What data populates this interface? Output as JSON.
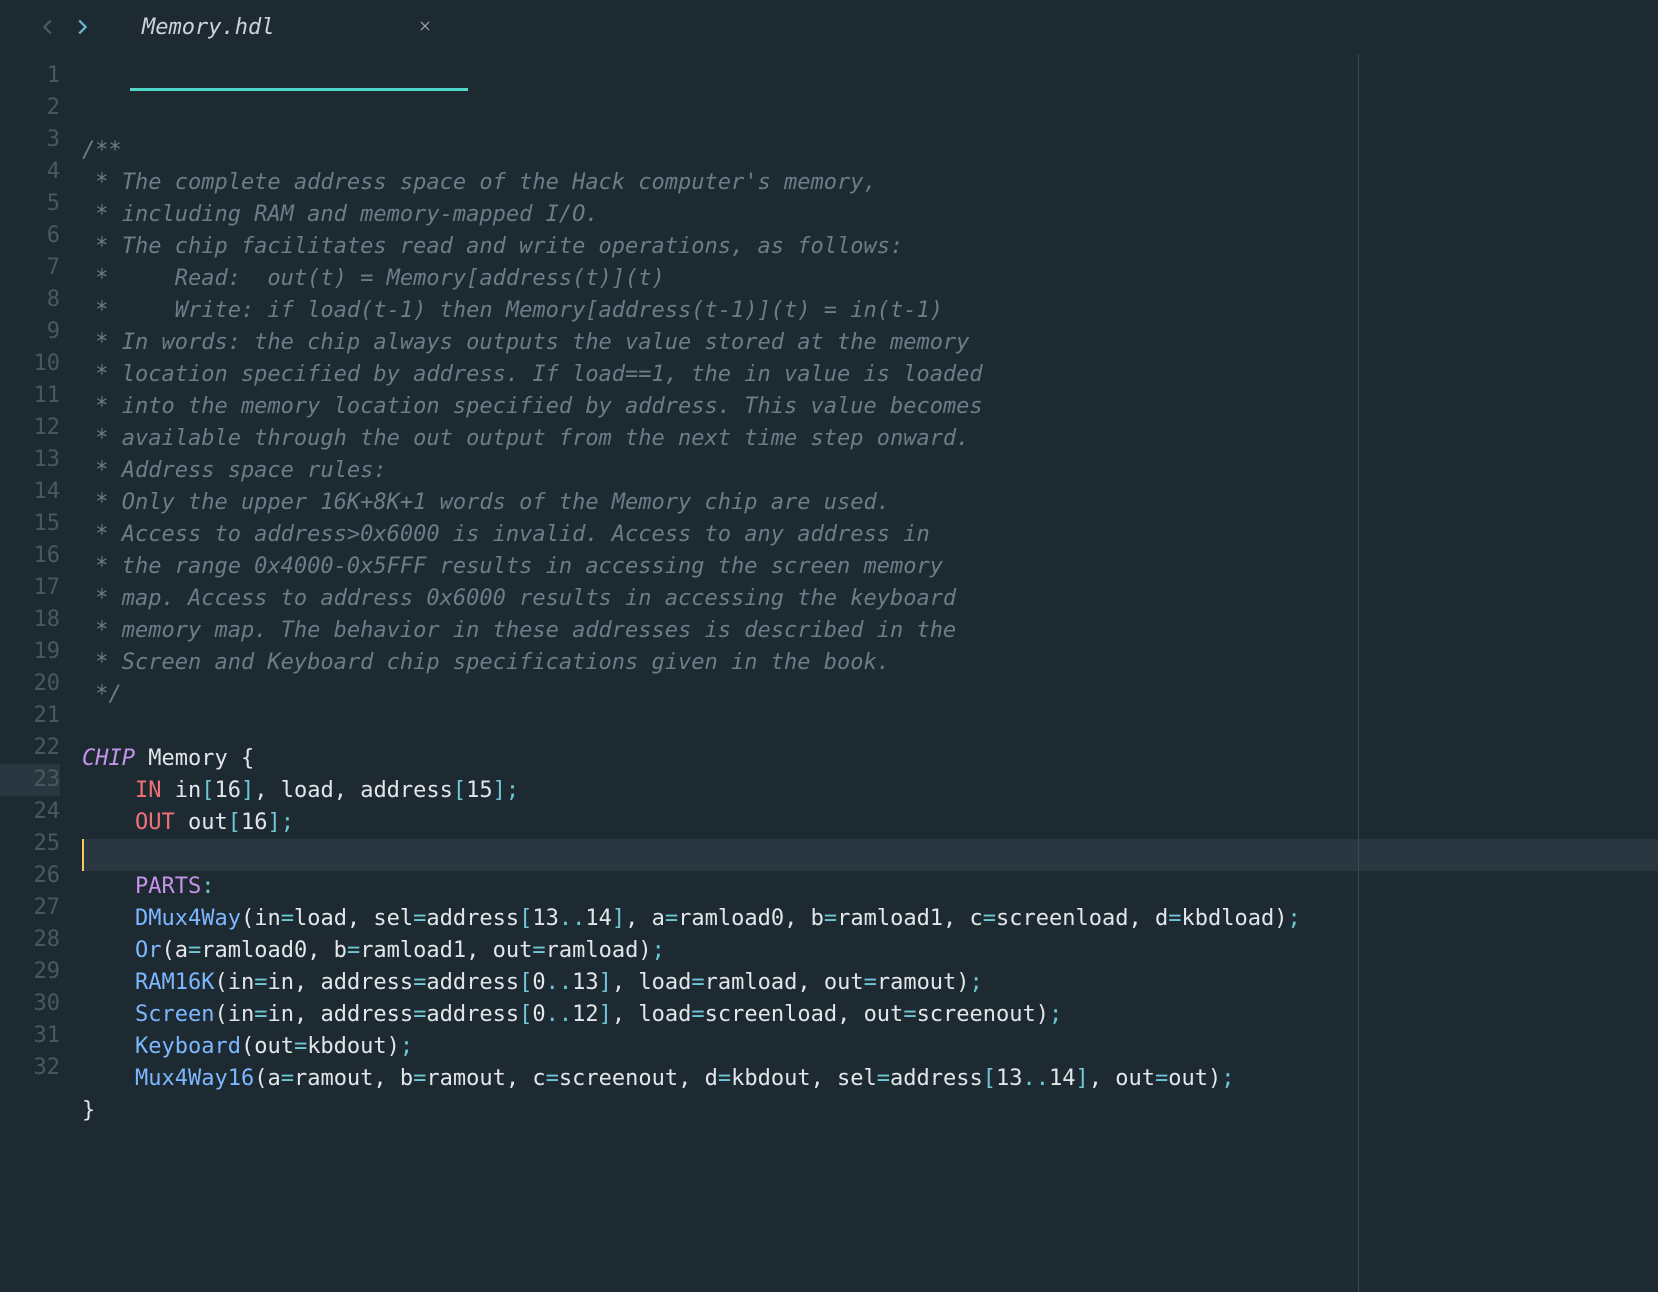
{
  "tab": {
    "filename": "Memory.hdl",
    "close_tooltip": "Close"
  },
  "editor": {
    "current_line": 23,
    "line_count": 32,
    "lines": [
      {
        "n": 1,
        "t": "/**",
        "cls": "cm"
      },
      {
        "n": 2,
        "t": " * The complete address space of the Hack computer's memory,",
        "cls": "cm"
      },
      {
        "n": 3,
        "t": " * including RAM and memory-mapped I/O.",
        "cls": "cm"
      },
      {
        "n": 4,
        "t": " * The chip facilitates read and write operations, as follows:",
        "cls": "cm"
      },
      {
        "n": 5,
        "t": " *     Read:  out(t) = Memory[address(t)](t)",
        "cls": "cm"
      },
      {
        "n": 6,
        "t": " *     Write: if load(t-1) then Memory[address(t-1)](t) = in(t-1)",
        "cls": "cm"
      },
      {
        "n": 7,
        "t": " * In words: the chip always outputs the value stored at the memory",
        "cls": "cm"
      },
      {
        "n": 8,
        "t": " * location specified by address. If load==1, the in value is loaded",
        "cls": "cm"
      },
      {
        "n": 9,
        "t": " * into the memory location specified by address. This value becomes",
        "cls": "cm"
      },
      {
        "n": 10,
        "t": " * available through the out output from the next time step onward.",
        "cls": "cm"
      },
      {
        "n": 11,
        "t": " * Address space rules:",
        "cls": "cm"
      },
      {
        "n": 12,
        "t": " * Only the upper 16K+8K+1 words of the Memory chip are used.",
        "cls": "cm"
      },
      {
        "n": 13,
        "t": " * Access to address>0x6000 is invalid. Access to any address in",
        "cls": "cm"
      },
      {
        "n": 14,
        "t": " * the range 0x4000-0x5FFF results in accessing the screen memory",
        "cls": "cm"
      },
      {
        "n": 15,
        "t": " * map. Access to address 0x6000 results in accessing the keyboard",
        "cls": "cm"
      },
      {
        "n": 16,
        "t": " * memory map. The behavior in these addresses is described in the",
        "cls": "cm"
      },
      {
        "n": 17,
        "t": " * Screen and Keyboard chip specifications given in the book.",
        "cls": "cm"
      },
      {
        "n": 18,
        "t": " */",
        "cls": "cm"
      },
      {
        "n": 19,
        "t": "",
        "cls": ""
      },
      {
        "n": 20,
        "segs": [
          {
            "t": "CHIP",
            "c": "kw"
          },
          {
            "t": " Memory ",
            "c": "id"
          },
          {
            "t": "{",
            "c": "id"
          }
        ]
      },
      {
        "n": 21,
        "segs": [
          {
            "t": "    ",
            "c": "id"
          },
          {
            "t": "IN",
            "c": "io"
          },
          {
            "t": " in",
            "c": "id"
          },
          {
            "t": "[",
            "c": "op"
          },
          {
            "t": "16",
            "c": "id"
          },
          {
            "t": "]",
            "c": "op"
          },
          {
            "t": ", load, address",
            "c": "id"
          },
          {
            "t": "[",
            "c": "op"
          },
          {
            "t": "15",
            "c": "id"
          },
          {
            "t": "];",
            "c": "op"
          }
        ]
      },
      {
        "n": 22,
        "segs": [
          {
            "t": "    ",
            "c": "id"
          },
          {
            "t": "OUT",
            "c": "io"
          },
          {
            "t": " out",
            "c": "id"
          },
          {
            "t": "[",
            "c": "op"
          },
          {
            "t": "16",
            "c": "id"
          },
          {
            "t": "];",
            "c": "op"
          }
        ]
      },
      {
        "n": 23,
        "t": "",
        "cls": "",
        "current": true
      },
      {
        "n": 24,
        "segs": [
          {
            "t": "    ",
            "c": "id"
          },
          {
            "t": "PARTS",
            "c": "lab"
          },
          {
            "t": ":",
            "c": "op"
          }
        ]
      },
      {
        "n": 25,
        "segs": [
          {
            "t": "    ",
            "c": "id"
          },
          {
            "t": "DMux4Way",
            "c": "fn"
          },
          {
            "t": "(in",
            "c": "id"
          },
          {
            "t": "=",
            "c": "op"
          },
          {
            "t": "load, sel",
            "c": "id"
          },
          {
            "t": "=",
            "c": "op"
          },
          {
            "t": "address",
            "c": "id"
          },
          {
            "t": "[",
            "c": "op"
          },
          {
            "t": "13",
            "c": "id"
          },
          {
            "t": "..",
            "c": "op"
          },
          {
            "t": "14",
            "c": "id"
          },
          {
            "t": "]",
            "c": "op"
          },
          {
            "t": ", a",
            "c": "id"
          },
          {
            "t": "=",
            "c": "op"
          },
          {
            "t": "ramload0, b",
            "c": "id"
          },
          {
            "t": "=",
            "c": "op"
          },
          {
            "t": "ramload1, c",
            "c": "id"
          },
          {
            "t": "=",
            "c": "op"
          },
          {
            "t": "screenload, d",
            "c": "id"
          },
          {
            "t": "=",
            "c": "op"
          },
          {
            "t": "kbdload)",
            "c": "id"
          },
          {
            "t": ";",
            "c": "op"
          }
        ]
      },
      {
        "n": 26,
        "segs": [
          {
            "t": "    ",
            "c": "id"
          },
          {
            "t": "Or",
            "c": "fn"
          },
          {
            "t": "(a",
            "c": "id"
          },
          {
            "t": "=",
            "c": "op"
          },
          {
            "t": "ramload0, b",
            "c": "id"
          },
          {
            "t": "=",
            "c": "op"
          },
          {
            "t": "ramload1, out",
            "c": "id"
          },
          {
            "t": "=",
            "c": "op"
          },
          {
            "t": "ramload)",
            "c": "id"
          },
          {
            "t": ";",
            "c": "op"
          }
        ]
      },
      {
        "n": 27,
        "segs": [
          {
            "t": "    ",
            "c": "id"
          },
          {
            "t": "RAM16K",
            "c": "fn"
          },
          {
            "t": "(in",
            "c": "id"
          },
          {
            "t": "=",
            "c": "op"
          },
          {
            "t": "in, address",
            "c": "id"
          },
          {
            "t": "=",
            "c": "op"
          },
          {
            "t": "address",
            "c": "id"
          },
          {
            "t": "[",
            "c": "op"
          },
          {
            "t": "0",
            "c": "id"
          },
          {
            "t": "..",
            "c": "op"
          },
          {
            "t": "13",
            "c": "id"
          },
          {
            "t": "]",
            "c": "op"
          },
          {
            "t": ", load",
            "c": "id"
          },
          {
            "t": "=",
            "c": "op"
          },
          {
            "t": "ramload, out",
            "c": "id"
          },
          {
            "t": "=",
            "c": "op"
          },
          {
            "t": "ramout)",
            "c": "id"
          },
          {
            "t": ";",
            "c": "op"
          }
        ]
      },
      {
        "n": 28,
        "segs": [
          {
            "t": "    ",
            "c": "id"
          },
          {
            "t": "Screen",
            "c": "fn"
          },
          {
            "t": "(in",
            "c": "id"
          },
          {
            "t": "=",
            "c": "op"
          },
          {
            "t": "in, address",
            "c": "id"
          },
          {
            "t": "=",
            "c": "op"
          },
          {
            "t": "address",
            "c": "id"
          },
          {
            "t": "[",
            "c": "op"
          },
          {
            "t": "0",
            "c": "id"
          },
          {
            "t": "..",
            "c": "op"
          },
          {
            "t": "12",
            "c": "id"
          },
          {
            "t": "]",
            "c": "op"
          },
          {
            "t": ", load",
            "c": "id"
          },
          {
            "t": "=",
            "c": "op"
          },
          {
            "t": "screenload, out",
            "c": "id"
          },
          {
            "t": "=",
            "c": "op"
          },
          {
            "t": "screenout)",
            "c": "id"
          },
          {
            "t": ";",
            "c": "op"
          }
        ]
      },
      {
        "n": 29,
        "segs": [
          {
            "t": "    ",
            "c": "id"
          },
          {
            "t": "Keyboard",
            "c": "fn"
          },
          {
            "t": "(out",
            "c": "id"
          },
          {
            "t": "=",
            "c": "op"
          },
          {
            "t": "kbdout)",
            "c": "id"
          },
          {
            "t": ";",
            "c": "op"
          }
        ]
      },
      {
        "n": 30,
        "segs": [
          {
            "t": "    ",
            "c": "id"
          },
          {
            "t": "Mux4Way16",
            "c": "fn"
          },
          {
            "t": "(a",
            "c": "id"
          },
          {
            "t": "=",
            "c": "op"
          },
          {
            "t": "ramout, b",
            "c": "id"
          },
          {
            "t": "=",
            "c": "op"
          },
          {
            "t": "ramout, c",
            "c": "id"
          },
          {
            "t": "=",
            "c": "op"
          },
          {
            "t": "screenout, d",
            "c": "id"
          },
          {
            "t": "=",
            "c": "op"
          },
          {
            "t": "kbdout, sel",
            "c": "id"
          },
          {
            "t": "=",
            "c": "op"
          },
          {
            "t": "address",
            "c": "id"
          },
          {
            "t": "[",
            "c": "op"
          },
          {
            "t": "13",
            "c": "id"
          },
          {
            "t": "..",
            "c": "op"
          },
          {
            "t": "14",
            "c": "id"
          },
          {
            "t": "]",
            "c": "op"
          },
          {
            "t": ", out",
            "c": "id"
          },
          {
            "t": "=",
            "c": "op"
          },
          {
            "t": "out)",
            "c": "id"
          },
          {
            "t": ";",
            "c": "op"
          }
        ]
      },
      {
        "n": 31,
        "segs": [
          {
            "t": "}",
            "c": "id"
          }
        ]
      },
      {
        "n": 32,
        "t": "",
        "cls": ""
      }
    ]
  }
}
